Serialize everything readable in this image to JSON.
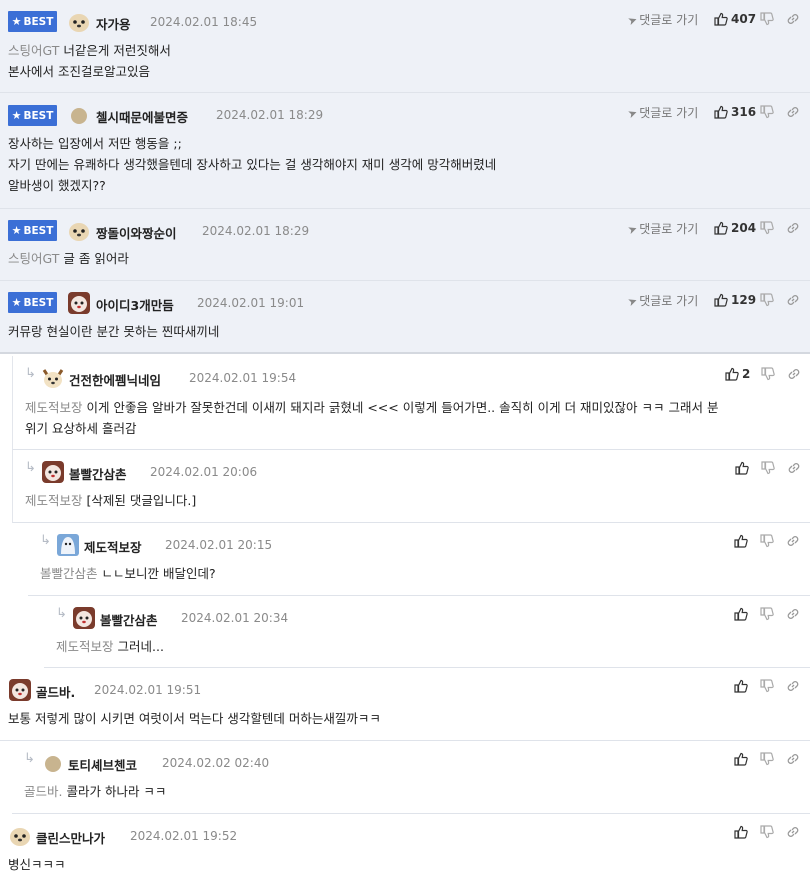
{
  "ui": {
    "best_label": "BEST",
    "reply_label": "댓글로 가기"
  },
  "comments": [
    {
      "nick": "자가용",
      "date": "2024.02.01 18:45",
      "likes": "407",
      "lines": [
        {
          "target": "스팅어GT",
          "text": "너같은게 저런짓해서"
        },
        {
          "target": "",
          "text": "본사에서 조진걸로알고있음"
        }
      ]
    },
    {
      "nick": "첼시때문에불면증",
      "date": "2024.02.01 18:29",
      "likes": "316",
      "lines": [
        {
          "target": "",
          "text": "장사하는 입장에서 저딴 행동을 ;;"
        },
        {
          "target": "",
          "text": "자기 딴에는 유쾌하다 생각했을텐데 장사하고 있다는 걸 생각해야지 재미 생각에 망각해버렸네"
        },
        {
          "target": "",
          "text": "알바생이 했겠지??"
        }
      ]
    },
    {
      "nick": "짱돌이와짱순이",
      "date": "2024.02.01 18:29",
      "likes": "204",
      "lines": [
        {
          "target": "스팅어GT",
          "text": "글 좀 읽어라"
        }
      ]
    },
    {
      "nick": "아이디3개만듬",
      "date": "2024.02.01 19:01",
      "likes": "129",
      "lines": [
        {
          "target": "",
          "text": "커뮤랑 현실이란 분간 못하는 찐따새끼네"
        }
      ]
    },
    {
      "nick": "건전한에펨닉네임",
      "date": "2024.02.01 19:54",
      "likes": "2",
      "lines": [
        {
          "target": "제도적보장",
          "text": "이게 안좋음 알바가 잘못한건데 이새끼 돼지라 긁혔네 <<< 이렇게 들어가면.. 솔직히 이게 더 재미있잖아 ㅋㅋ 그래서 분"
        },
        {
          "target": "",
          "text": "위기 요상하세 흘러감"
        }
      ]
    },
    {
      "nick": "볼빨간삼촌",
      "date": "2024.02.01 20:06",
      "likes": "",
      "lines": [
        {
          "target": "제도적보장",
          "text": "[삭제된 댓글입니다.]"
        }
      ]
    },
    {
      "nick": "제도적보장",
      "date": "2024.02.01 20:15",
      "likes": "",
      "lines": [
        {
          "target": "볼빨간삼촌",
          "text": "ㄴㄴ보니깐 배달인데?"
        }
      ]
    },
    {
      "nick": "볼빨간삼촌",
      "date": "2024.02.01 20:34",
      "likes": "",
      "lines": [
        {
          "target": "제도적보장",
          "text": "그러네..."
        }
      ]
    },
    {
      "nick": "골드바.",
      "date": "2024.02.01 19:51",
      "likes": "",
      "lines": [
        {
          "target": "",
          "text": "보통 저렇게 많이 시키면 여럿이서 먹는다 생각할텐데 머하는새낄까ㅋㅋ"
        }
      ]
    },
    {
      "nick": "토티셰브첸코",
      "date": "2024.02.02 02:40",
      "likes": "",
      "lines": [
        {
          "target": "골드바.",
          "text": "콜라가 하나라 ㅋㅋ"
        }
      ]
    },
    {
      "nick": "클린스만나가",
      "date": "2024.02.01 19:52",
      "likes": "",
      "lines": [
        {
          "target": "",
          "text": "병신ㅋㅋㅋ"
        }
      ]
    }
  ]
}
